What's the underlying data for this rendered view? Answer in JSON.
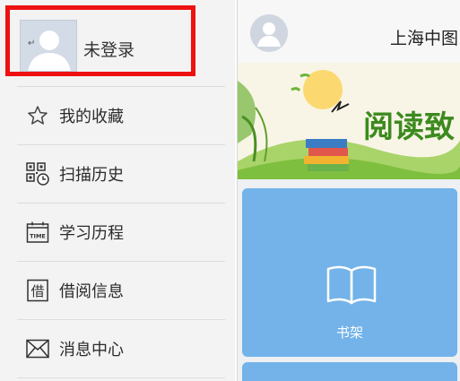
{
  "drawer": {
    "user": {
      "name": "未登录",
      "enter_glyph": "↵",
      "highlight_color": "#ee1111"
    },
    "items": [
      {
        "label": "我的收藏",
        "icon": "star-icon"
      },
      {
        "label": "扫描历史",
        "icon": "qr-history-icon"
      },
      {
        "label": "学习历程",
        "icon": "time-calendar-icon"
      },
      {
        "label": "借阅信息",
        "icon": "borrow-icon"
      },
      {
        "label": "消息中心",
        "icon": "mail-icon"
      }
    ],
    "calendar_icon_text": "TIME",
    "borrow_icon_text": "借"
  },
  "main": {
    "title": "上海中图",
    "banner_text": "阅读致",
    "tile_label": "书架",
    "accent": "#73b3e9"
  }
}
